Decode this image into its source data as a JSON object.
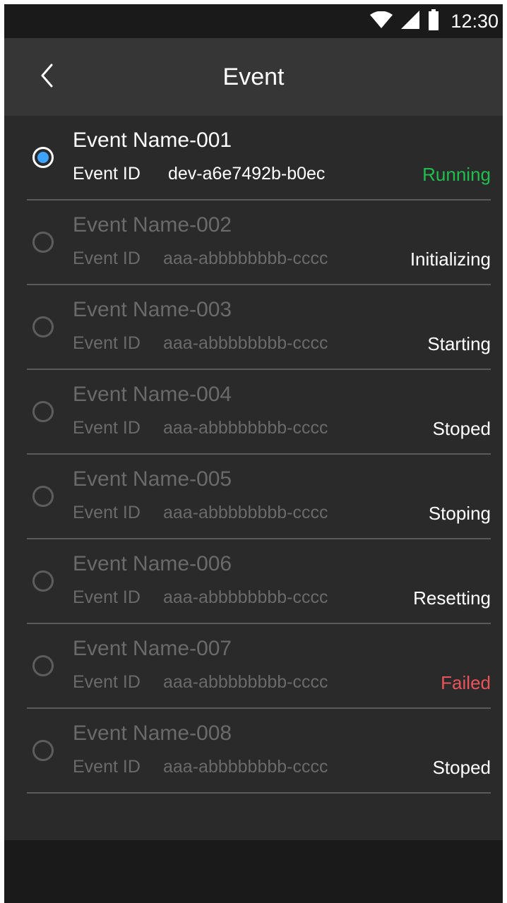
{
  "status_bar": {
    "time": "12:30",
    "icons": [
      "wifi-icon",
      "cellular-signal-icon",
      "battery-icon"
    ]
  },
  "app_bar": {
    "title": "Event",
    "back_icon": "chevron-left-icon"
  },
  "id_label": "Event ID",
  "colors": {
    "running": "#1fbf4d",
    "failed": "#e8545a",
    "radio_selected": "#3ea2ff"
  },
  "events": [
    {
      "name": "Event Name-001",
      "id": "dev-a6e7492b-b0ec",
      "status": "Running",
      "status_color": "#1fbf4d",
      "selected": true
    },
    {
      "name": "Event Name-002",
      "id": "aaa-abbbbbbbb-cccc",
      "status": "Initializing",
      "status_color": "#ffffff",
      "selected": false
    },
    {
      "name": "Event Name-003",
      "id": "aaa-abbbbbbbb-cccc",
      "status": "Starting",
      "status_color": "#ffffff",
      "selected": false
    },
    {
      "name": "Event Name-004",
      "id": "aaa-abbbbbbbb-cccc",
      "status": "Stoped",
      "status_color": "#ffffff",
      "selected": false
    },
    {
      "name": "Event Name-005",
      "id": "aaa-abbbbbbbb-cccc",
      "status": "Stoping",
      "status_color": "#ffffff",
      "selected": false
    },
    {
      "name": "Event Name-006",
      "id": "aaa-abbbbbbbb-cccc",
      "status": "Resetting",
      "status_color": "#ffffff",
      "selected": false
    },
    {
      "name": "Event Name-007",
      "id": "aaa-abbbbbbbb-cccc",
      "status": "Failed",
      "status_color": "#e8545a",
      "selected": false
    },
    {
      "name": "Event Name-008",
      "id": "aaa-abbbbbbbb-cccc",
      "status": "Stoped",
      "status_color": "#ffffff",
      "selected": false
    }
  ]
}
